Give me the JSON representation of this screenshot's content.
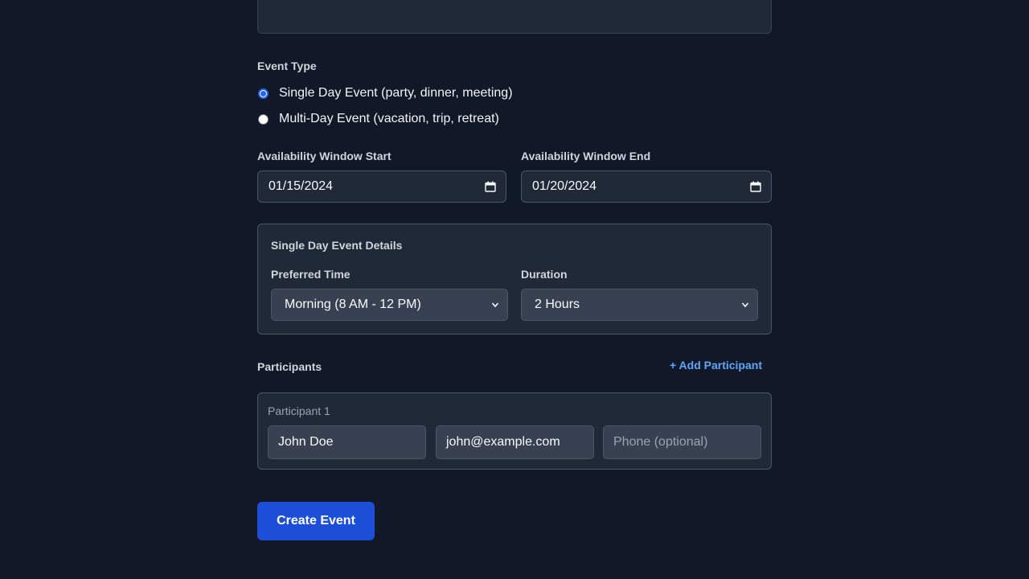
{
  "form": {
    "event_type": {
      "label": "Event Type",
      "options": [
        {
          "label": "Single Day Event (party, dinner, meeting)",
          "checked": true
        },
        {
          "label": "Multi-Day Event (vacation, trip, retreat)",
          "checked": false
        }
      ]
    },
    "availability": {
      "start_label": "Availability Window Start",
      "start_value": "01/15/2024",
      "end_label": "Availability Window End",
      "end_value": "01/20/2024"
    },
    "single_day_details": {
      "title": "Single Day Event Details",
      "preferred_time_label": "Preferred Time",
      "preferred_time_value": "Morning (8 AM - 12 PM)",
      "duration_label": "Duration",
      "duration_value": "2 Hours"
    },
    "participants": {
      "label": "Participants",
      "add_label": "+ Add Participant",
      "items": [
        {
          "heading": "Participant 1",
          "name": "John Doe",
          "email": "john@example.com",
          "phone_placeholder": "Phone (optional)"
        }
      ]
    },
    "submit_label": "Create Event"
  },
  "colors": {
    "background": "#111827",
    "panel": "#1f2937",
    "accent": "#1d4ed8",
    "link": "#60a5fa"
  }
}
